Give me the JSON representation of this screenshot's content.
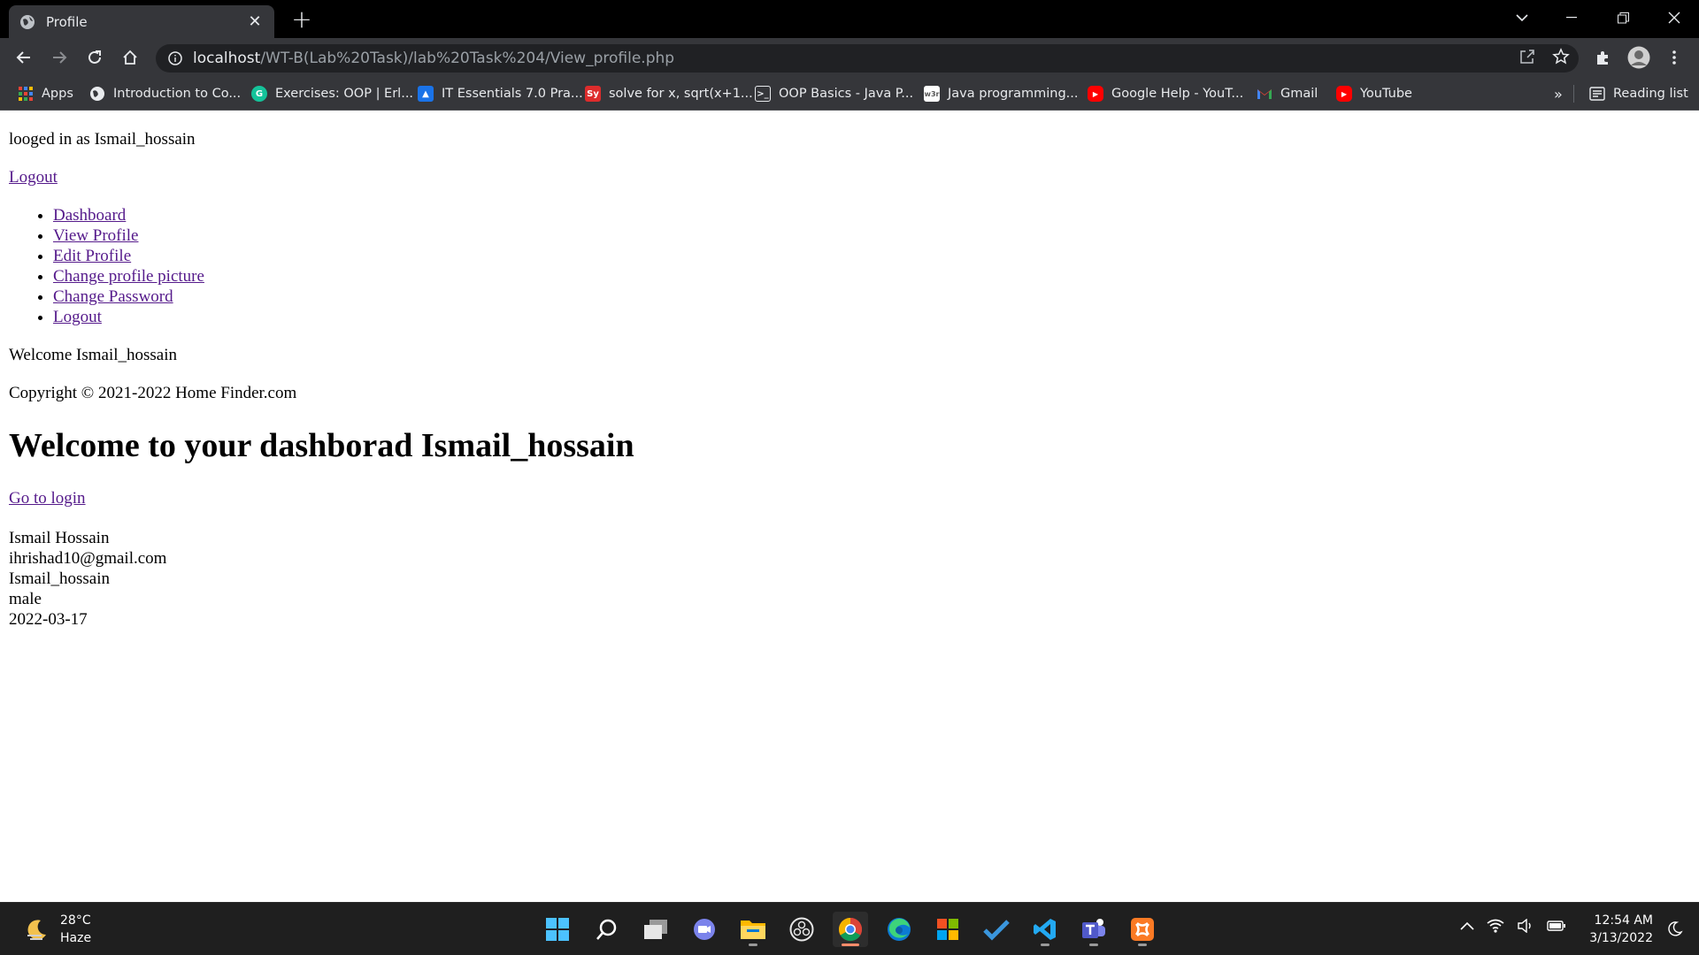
{
  "browser": {
    "tab_title": "Profile",
    "url_host": "localhost",
    "url_path": "/WT-B(Lab%20Task)/lab%20Task%204/View_profile.php",
    "bookmarks": [
      {
        "label": "Apps",
        "icon": "apps-grid-icon"
      },
      {
        "label": "Introduction to Co...",
        "icon": "globe-icon"
      },
      {
        "label": "Exercises: OOP | Erl...",
        "icon": "grammarly-icon"
      },
      {
        "label": "IT Essentials 7.0 Pra...",
        "icon": "doc-icon"
      },
      {
        "label": "solve for x, sqrt(x+1...",
        "icon": "symbolab-icon"
      },
      {
        "label": "OOP Basics - Java P...",
        "icon": "terminal-icon"
      },
      {
        "label": "Java programming...",
        "icon": "w3r-icon"
      },
      {
        "label": "Google Help - YouT...",
        "icon": "youtube-icon"
      },
      {
        "label": "Gmail",
        "icon": "gmail-icon"
      },
      {
        "label": "YouTube",
        "icon": "youtube-icon"
      }
    ],
    "overflow": "»",
    "reading_list": "Reading list"
  },
  "page": {
    "logged_in_text": "looged in as Ismail_hossain",
    "logout_top": "Logout",
    "nav": [
      {
        "label": "Dashboard"
      },
      {
        "label": "View Profile"
      },
      {
        "label": "Edit Profile"
      },
      {
        "label": "Change profile picture"
      },
      {
        "label": "Change Password"
      },
      {
        "label": "Logout"
      }
    ],
    "welcome_text": "Welcome Ismail_hossain",
    "copyright": "Copyright © 2021-2022 Home Finder.com",
    "heading": "Welcome to your dashborad Ismail_hossain",
    "go_to_login": "Go to login",
    "profile": {
      "name": "Ismail Hossain",
      "email": "ihrishad10@gmail.com",
      "username": "Ismail_hossain",
      "gender": "male",
      "date": "2022-03-17"
    }
  },
  "taskbar": {
    "temperature": "28°C",
    "weather": "Haze",
    "time": "12:54 AM",
    "date": "3/13/2022"
  },
  "colors": {
    "link": "#551a8b",
    "chrome_dark": "#35363a",
    "tab_strip": "#000000",
    "taskbar": "#1f1f1f"
  }
}
